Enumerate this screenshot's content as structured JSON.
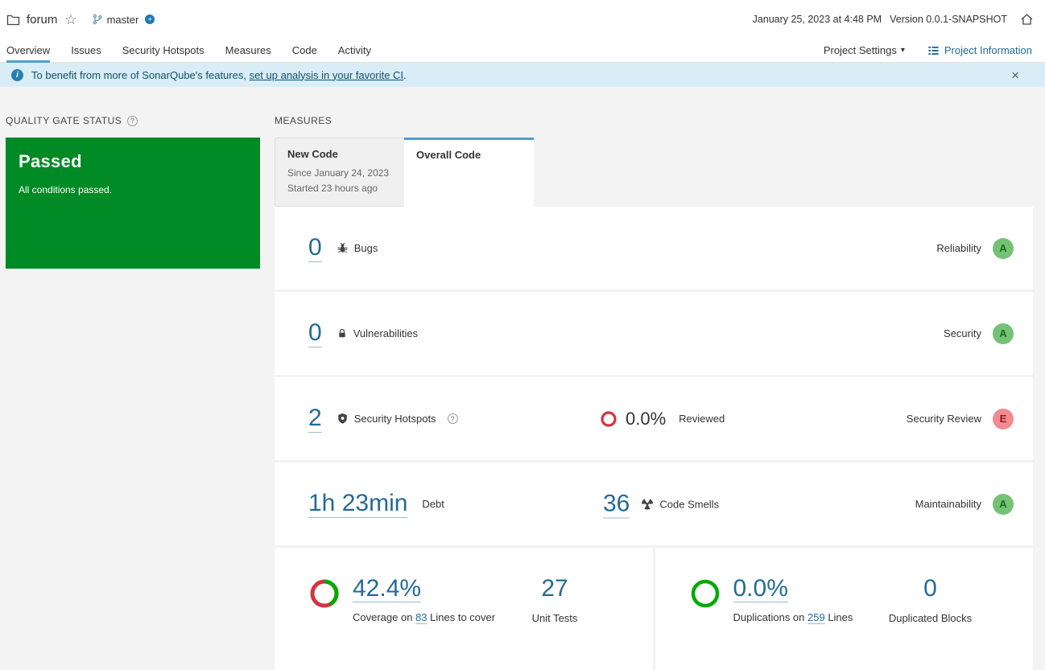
{
  "colors": {
    "passed_green": "#008a25",
    "accent_blue": "#4b9fd5",
    "link_blue": "#236a97",
    "banner_bg": "#d9edf7",
    "rating_a_bg": "#74c276",
    "rating_e_bg": "#f08b8f",
    "ring_red": "#d4333f",
    "ring_green": "#00aa00"
  },
  "header": {
    "project_name": "forum",
    "branch_name": "master",
    "timestamp": "January 25, 2023 at 4:48 PM",
    "version": "Version 0.0.1-SNAPSHOT"
  },
  "nav": {
    "tabs": [
      {
        "label": "Overview"
      },
      {
        "label": "Issues"
      },
      {
        "label": "Security Hotspots"
      },
      {
        "label": "Measures"
      },
      {
        "label": "Code"
      },
      {
        "label": "Activity"
      }
    ],
    "project_settings": "Project Settings",
    "project_information": "Project Information"
  },
  "banner": {
    "prefix": "To benefit from more of SonarQube's features, ",
    "link": "set up analysis in your favorite CI",
    "suffix": "."
  },
  "quality_gate": {
    "title": "QUALITY GATE STATUS",
    "status": "Passed",
    "detail": "All conditions passed."
  },
  "measures": {
    "title": "MEASURES",
    "new_code_tab": {
      "label": "New Code",
      "since": "Since January 24, 2023",
      "started": "Started 23 hours ago"
    },
    "overall_code_tab": {
      "label": "Overall Code"
    },
    "bugs": {
      "value": "0",
      "label": "Bugs",
      "domain": "Reliability",
      "rating": "A"
    },
    "vulnerabilities": {
      "value": "0",
      "label": "Vulnerabilities",
      "domain": "Security",
      "rating": "A"
    },
    "hotspots": {
      "value": "2",
      "label": "Security Hotspots",
      "reviewed_value": "0.0%",
      "reviewed_label": "Reviewed",
      "domain": "Security Review",
      "rating": "E"
    },
    "maintainability": {
      "debt_value": "1h 23min",
      "debt_label": "Debt",
      "smells_value": "36",
      "smells_label": "Code Smells",
      "domain": "Maintainability",
      "rating": "A"
    },
    "coverage": {
      "value": "42.4%",
      "percent": 42.4,
      "desc_prefix": "Coverage on ",
      "lines_link": "83",
      "desc_suffix": " Lines to cover",
      "tests_value": "27",
      "tests_label": "Unit Tests"
    },
    "duplications": {
      "value": "0.0%",
      "percent": 0,
      "desc_prefix": "Duplications on ",
      "lines_link": "259",
      "desc_suffix": " Lines",
      "blocks_value": "0",
      "blocks_label": "Duplicated Blocks"
    }
  }
}
